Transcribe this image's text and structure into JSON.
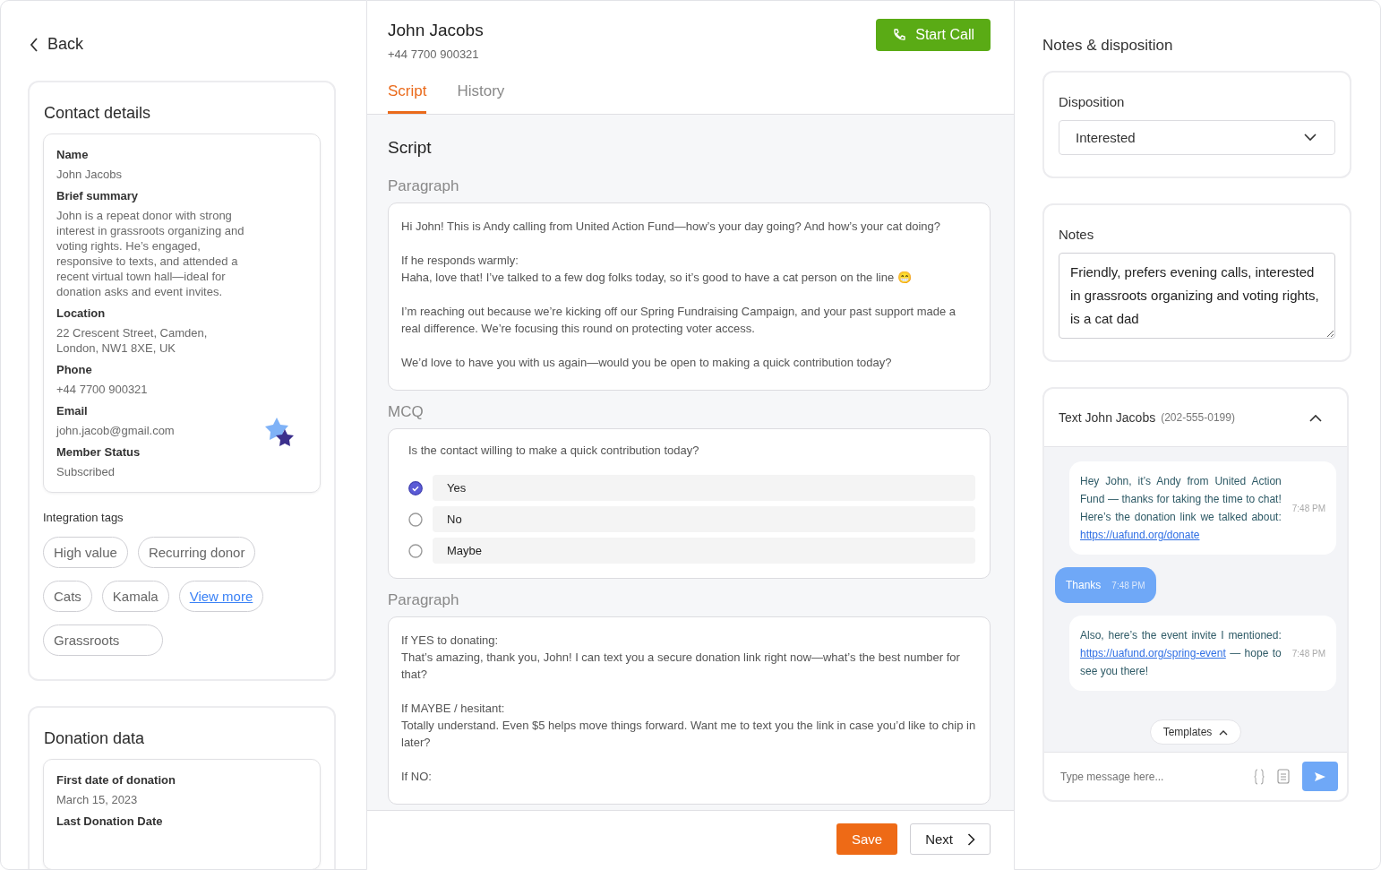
{
  "left": {
    "back": "Back",
    "contact": {
      "title": "Contact details",
      "fields": [
        {
          "label": "Name",
          "value": "John Jacobs"
        },
        {
          "label": "Brief summary",
          "value": "John is a repeat donor with strong interest in grassroots organizing and voting rights. He’s engaged, responsive to texts, and attended a recent virtual town hall—ideal for donation asks and event invites."
        },
        {
          "label": "Location",
          "value": "22 Crescent Street, Camden, London, NW1 8XE, UK"
        },
        {
          "label": "Phone",
          "value": "+44 7700 900321"
        },
        {
          "label": "Email",
          "value": "john.jacob@gmail.com"
        },
        {
          "label": "Member Status",
          "value": "Subscribed"
        }
      ],
      "tags_title": "Integration tags",
      "tags": [
        {
          "kind": "tag",
          "text": "High value"
        },
        {
          "kind": "tag",
          "text": "Recurring donor"
        },
        {
          "kind": "tag",
          "text": "Cats"
        },
        {
          "kind": "tag",
          "text": "Kamala"
        },
        {
          "kind": "link",
          "text": "View more"
        },
        {
          "kind": "wide",
          "text": "Grassroots"
        }
      ]
    },
    "donation": {
      "title": "Donation data",
      "fields": [
        {
          "label": "First date of donation",
          "value": "March 15, 2023"
        },
        {
          "label": "Last Donation Date"
        }
      ]
    }
  },
  "main": {
    "name": "John Jacobs",
    "phone": "+44 7700 900321",
    "start_call": "Start Call",
    "tabs": [
      {
        "label": "Script",
        "selected": true
      },
      {
        "label": "History",
        "selected": false
      }
    ],
    "section_title": "Script",
    "blocks": [
      {
        "kind": "paragraph",
        "heading": "Paragraph",
        "paragraphs": [
          [
            "Hi John! This is Andy calling from United Action Fund—how’s your day going? And how’s your cat doing?"
          ],
          [
            "If he responds warmly:",
            "Haha, love that! I’ve talked to a few dog folks today, so it’s good to have a cat person on the line 😁"
          ],
          [
            "I’m reaching out because we’re kicking off our Spring Fundraising Campaign, and your past support made a real difference. We’re focusing this round on protecting voter access."
          ],
          [
            "We’d love to have you with us again—would you be open to making a quick contribution today?"
          ]
        ]
      },
      {
        "kind": "mcq",
        "heading": "MCQ",
        "question": "Is the contact willing to make a quick contribution today?",
        "options": [
          {
            "label": "Yes",
            "selected": true
          },
          {
            "label": "No",
            "selected": false
          },
          {
            "label": "Maybe",
            "selected": false
          }
        ]
      },
      {
        "kind": "paragraph",
        "heading": "Paragraph",
        "paragraphs": [
          [
            "If YES to donating:",
            "That’s amazing, thank you, John! I can text you a secure donation link right now—what’s the best number for that?"
          ],
          [
            "If MAYBE / hesitant:",
            "Totally understand. Even $5 helps move things forward. Want me to text you the link in case you’d like to chip in later?"
          ],
          [
            "If NO:"
          ]
        ]
      }
    ],
    "save": "Save",
    "next": "Next"
  },
  "right": {
    "title": "Notes & disposition",
    "disposition_label": "Disposition",
    "disposition_value": "Interested",
    "notes_label": "Notes",
    "notes_value": "Friendly, prefers evening calls, interested in grassroots organizing and voting rights, is a cat dad",
    "sms": {
      "title": "Text John Jacobs",
      "number": "(202-555-0199)",
      "expanded": true,
      "messages": [
        {
          "kind": "incoming",
          "time": "7:48 PM",
          "parts": [
            {
              "kind": "text",
              "text": "Hey John, it’s Andy from United Action Fund — thanks for taking the time to chat! Here’s the donation link we talked about: "
            },
            {
              "kind": "link",
              "text": "https://uafund.org/donate"
            }
          ]
        },
        {
          "kind": "outgoing",
          "time": "7:48 PM",
          "parts": [
            {
              "kind": "text",
              "text": "Thanks"
            }
          ]
        },
        {
          "kind": "incoming",
          "time": "7:48 PM",
          "parts": [
            {
              "kind": "text",
              "text": "Also, here’s the event invite I mentioned: "
            },
            {
              "kind": "link",
              "text": "https://uafund.org/spring-event"
            },
            {
              "kind": "text",
              "text": " — hope to see you there!"
            }
          ]
        }
      ],
      "templates": "Templates",
      "placeholder": "Type message here..."
    }
  }
}
